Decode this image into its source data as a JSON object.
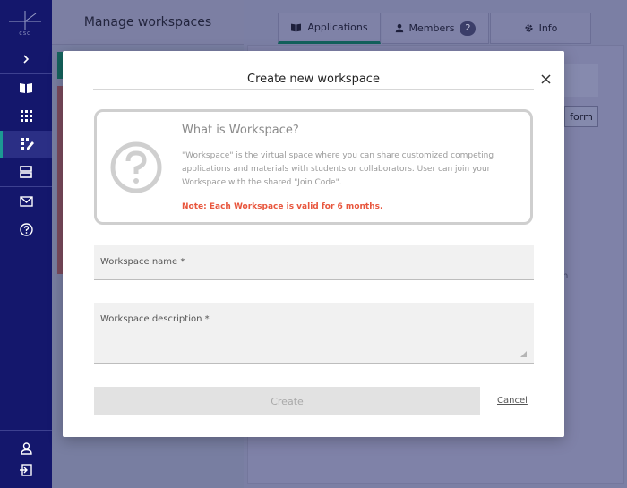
{
  "sidebar": {
    "logo_text": "CSC",
    "icons": [
      "expand-icon",
      "book-icon",
      "apps-grid-icon",
      "workspace-icon",
      "storage-icon",
      "mail-icon",
      "help-icon",
      "user-icon",
      "logout-icon"
    ],
    "active_item": "workspace-icon"
  },
  "background": {
    "left_panel_title": "Manage workspaces",
    "tabs": [
      {
        "label": "Applications",
        "icon": "book-icon"
      },
      {
        "label": "Members",
        "icon": "person-icon",
        "badge": "2"
      },
      {
        "label": "Info",
        "icon": "gear-icon"
      }
    ],
    "partial_button_text": "form",
    "partial_text": "n"
  },
  "modal": {
    "title": "Create new workspace",
    "info": {
      "heading": "What is Workspace?",
      "description": "\"Workspace\" is the virtual space where you can share customized competing applications and materials with students or collaborators. User can join your Workspace with the shared \"Join Code\".",
      "note": "Note: Each Workspace is valid for 6 months."
    },
    "fields": {
      "name_label": "Workspace name *",
      "description_label": "Workspace description *"
    },
    "create_label": "Create",
    "cancel_label": "Cancel"
  },
  "colors": {
    "sidebar_bg": "#14176c",
    "accent_teal": "#1c9a93",
    "note_red": "#e8563d",
    "overlay": "#7f7fa9"
  }
}
